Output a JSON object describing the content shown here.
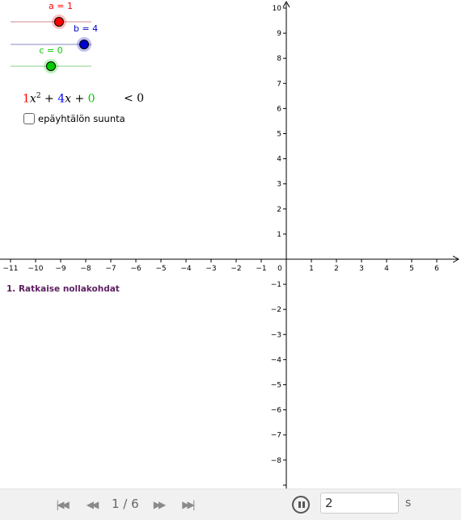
{
  "sliders": [
    {
      "name": "a",
      "label": "a = 1",
      "value": 1,
      "min": -5,
      "max": 1,
      "color": "#ff0000",
      "line_color": "#d9a0a0"
    },
    {
      "name": "b",
      "label": "b = 4",
      "value": 4,
      "min": -6,
      "max": 4,
      "color": "#0000cc",
      "line_color": "#9fa0cf"
    },
    {
      "name": "c",
      "label": "c = 0",
      "value": 0,
      "min": -5,
      "max": 5,
      "color": "#00cc00",
      "line_color": "#9fd99f"
    }
  ],
  "formula": {
    "a_coef": "1",
    "x2": "x",
    "exp": "2",
    "plus1": "+",
    "b_coef": "4",
    "x": "x",
    "plus2": "+",
    "c_coef": "0",
    "relation": "< 0",
    "colors": {
      "a": "#ff0000",
      "b": "#0000ff",
      "c": "#00cc00"
    }
  },
  "checkbox": {
    "label": "epäyhtälön suunta",
    "checked": false
  },
  "step_title": "1. Ratkaise nollakohdat",
  "axes": {
    "x_ticks": [
      "−11",
      "−10",
      "−9",
      "−8",
      "−7",
      "−6",
      "−5",
      "−4",
      "−3",
      "−2",
      "−1",
      "0",
      "1",
      "2",
      "3",
      "4",
      "5",
      "6"
    ],
    "y_ticks_pos": [
      "1",
      "2",
      "3",
      "4",
      "5",
      "6",
      "7",
      "8",
      "9",
      "10"
    ],
    "y_ticks_neg": [
      "−1",
      "−2",
      "−3",
      "−4",
      "−5",
      "−6",
      "−7",
      "−8"
    ]
  },
  "toolbar": {
    "page": "1 / 6",
    "speed": "2",
    "unit": "s",
    "icons": [
      "skip-first-icon",
      "step-back-icon",
      "step-forward-icon",
      "skip-last-icon",
      "pause-icon"
    ]
  }
}
